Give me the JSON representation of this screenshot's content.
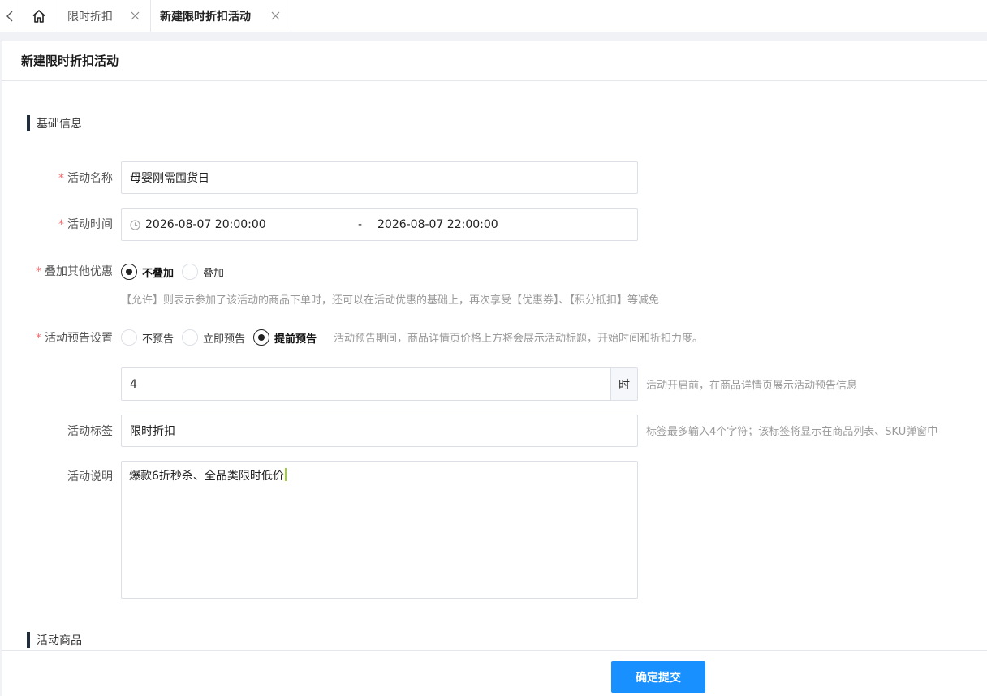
{
  "tabs": {
    "back_icon": "chevron-left-icon",
    "home_icon": "home-icon",
    "items": [
      {
        "label": "限时折扣",
        "active": false
      },
      {
        "label": "新建限时折扣活动",
        "active": true
      }
    ]
  },
  "page": {
    "title": "新建限时折扣活动"
  },
  "sections": {
    "basic": "基础信息",
    "goods": "活动商品"
  },
  "form": {
    "name": {
      "label": "活动名称",
      "value": "母婴刚需囤货日"
    },
    "time": {
      "label": "活动时间",
      "start": "2026-08-07 20:00:00",
      "separator": "-",
      "end": "2026-08-07 22:00:00"
    },
    "stack": {
      "label": "叠加其他优惠",
      "options": [
        "不叠加",
        "叠加"
      ],
      "selected": "不叠加",
      "hint": "【允许】则表示参加了该活动的商品下单时，还可以在活动优惠的基础上，再次享受【优惠券】、【积分抵扣】等减免"
    },
    "preview": {
      "label": "活动预告设置",
      "options": [
        "不预告",
        "立即预告",
        "提前预告"
      ],
      "selected": "提前预告",
      "hint": "活动预告期间，商品详情页价格上方将会展示活动标题，开始时间和折扣力度。"
    },
    "advance": {
      "value": "4",
      "unit": "时",
      "hint": "活动开启前，在商品详情页展示活动预告信息"
    },
    "tag": {
      "label": "活动标签",
      "value": "限时折扣",
      "hint": "标签最多输入4个字符；该标签将显示在商品列表、SKU弹窗中"
    },
    "desc": {
      "label": "活动说明",
      "value": "爆款6折秒杀、全品类限时低价"
    },
    "required_mark": "*"
  },
  "footer": {
    "submit_label": "确定提交"
  },
  "colors": {
    "primary": "#1890ff",
    "required": "#f56c6c",
    "section_bar": "#1f2d3d"
  }
}
